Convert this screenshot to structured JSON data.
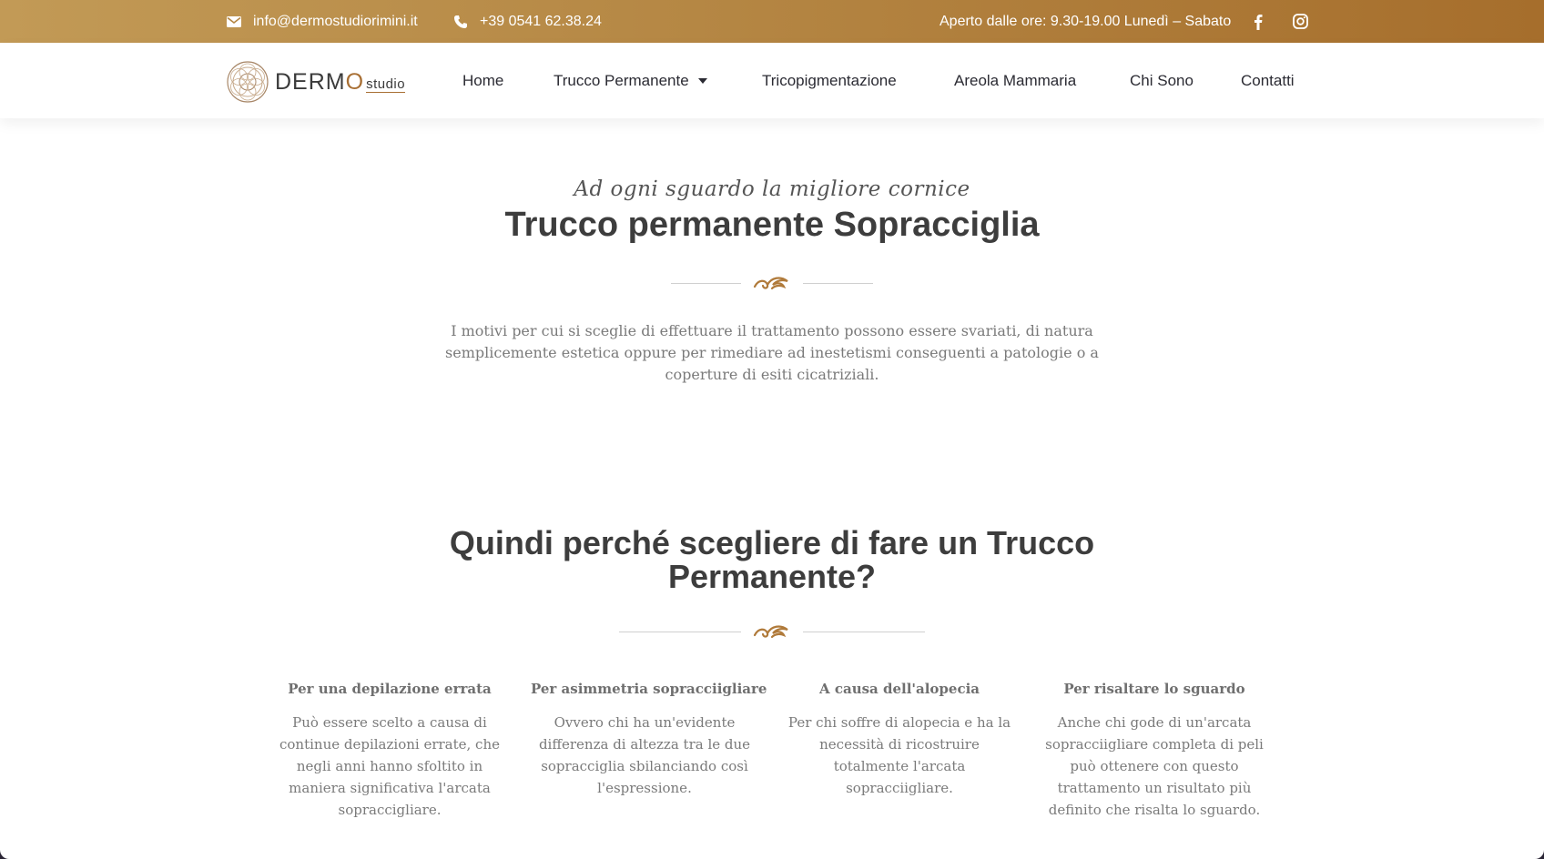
{
  "topbar": {
    "email": "info@dermostudiorimini.it",
    "phone": "+39 0541 62.38.24",
    "hours": "Aperto dalle ore: 9.30-19.00 Lunedì – Sabato",
    "icons": [
      "envelope-icon",
      "phone-icon",
      "facebook-icon",
      "instagram-icon"
    ]
  },
  "logo": {
    "word_a": "DER",
    "word_b": "M",
    "word_c": "O",
    "studio": "studio"
  },
  "nav": {
    "home": "Home",
    "trucco": "Trucco Permanente",
    "trico": "Tricopigmentazione",
    "areola": "Areola Mammaria",
    "chi": "Chi Sono",
    "contatti": "Contatti"
  },
  "hero": {
    "tagline": "Ad ogni sguardo la migliore cornice",
    "title": "Trucco permanente Sopracciglia",
    "intro": "I motivi per cui si sceglie di effettuare il trattamento possono essere svariati, di natura semplicemente estetica oppure per rimediare ad inestetismi conseguenti a patologie o a coperture di esiti cicatriziali."
  },
  "why": {
    "title_line1": "Quindi perché scegliere di fare un Trucco",
    "title_line2": "Permanente?",
    "items": [
      {
        "title": "Per una depilazione errata",
        "text": "Può essere scelto a causa di continue depilazioni errate, che negli anni hanno sfoltito in maniera significativa l'arcata sopraccigliare."
      },
      {
        "title": "Per asimmetria sopracciigliare",
        "text": "Ovvero chi ha un'evidente differenza di altezza tra le due sopracciglia sbilanciando così l'espressione."
      },
      {
        "title": "A causa dell'alopecia",
        "text": "Per chi soffre di alopecia e ha la necessità di ricostruire totalmente l'arcata sopracciigliare."
      },
      {
        "title": "Per risaltare lo sguardo",
        "text": "Anche chi gode di un'arcata sopracciigliare completa di peli può ottenere con questo trattamento un risultato più definito che risalta lo sguardo."
      }
    ]
  },
  "colors": {
    "gold_start": "#c29a56",
    "gold_end": "#a66e2c",
    "heading": "#3d3d3d",
    "body_text": "#7a7a7a"
  }
}
